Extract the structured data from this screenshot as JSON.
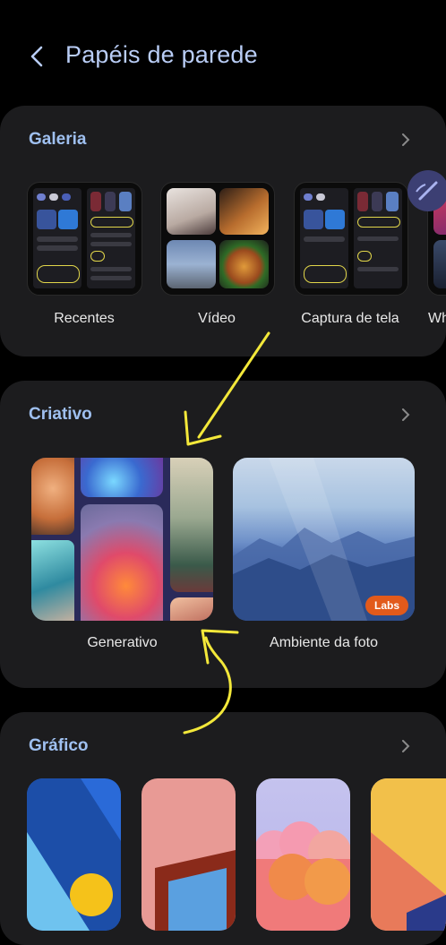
{
  "header": {
    "title": "Papéis de parede"
  },
  "galeria": {
    "title": "Galeria",
    "items": [
      {
        "label": "Recentes"
      },
      {
        "label": "Vídeo"
      },
      {
        "label": "Captura de tela"
      },
      {
        "label": "Wh"
      }
    ]
  },
  "criativo": {
    "title": "Criativo",
    "items": [
      {
        "label": "Generativo"
      },
      {
        "label": "Ambiente da foto",
        "badge": "Labs"
      }
    ]
  },
  "grafico": {
    "title": "Gráfico"
  },
  "colors": {
    "accent": "#9fc0f0",
    "card": "#1c1c1e",
    "annotation": "#f3e83a",
    "badge": "#e25a1b"
  }
}
